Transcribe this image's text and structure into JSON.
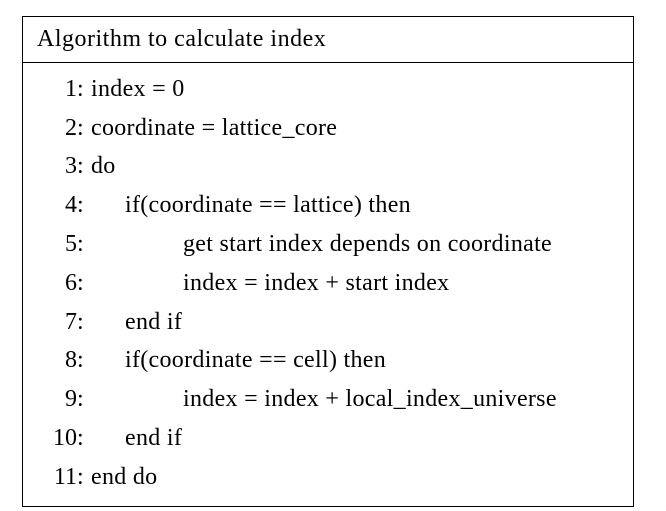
{
  "algorithm": {
    "title": "Algorithm to calculate index",
    "lines": [
      {
        "n": "1",
        "indent": 0,
        "text": "index = 0"
      },
      {
        "n": "2",
        "indent": 0,
        "text": "coordinate = lattice_core"
      },
      {
        "n": "3",
        "indent": 0,
        "text": "do"
      },
      {
        "n": "4",
        "indent": 1,
        "text": "if(coordinate == lattice) then"
      },
      {
        "n": "5",
        "indent": 2,
        "text": "get start index depends on coordinate"
      },
      {
        "n": "6",
        "indent": 2,
        "text": "index = index + start index"
      },
      {
        "n": "7",
        "indent": 1,
        "text": "end if"
      },
      {
        "n": "8",
        "indent": 1,
        "text": "if(coordinate == cell) then"
      },
      {
        "n": "9",
        "indent": 2,
        "text": "index = index + local_index_universe"
      },
      {
        "n": "10",
        "indent": 1,
        "text": "end if"
      },
      {
        "n": "11",
        "indent": 0,
        "text": "end do"
      }
    ]
  }
}
